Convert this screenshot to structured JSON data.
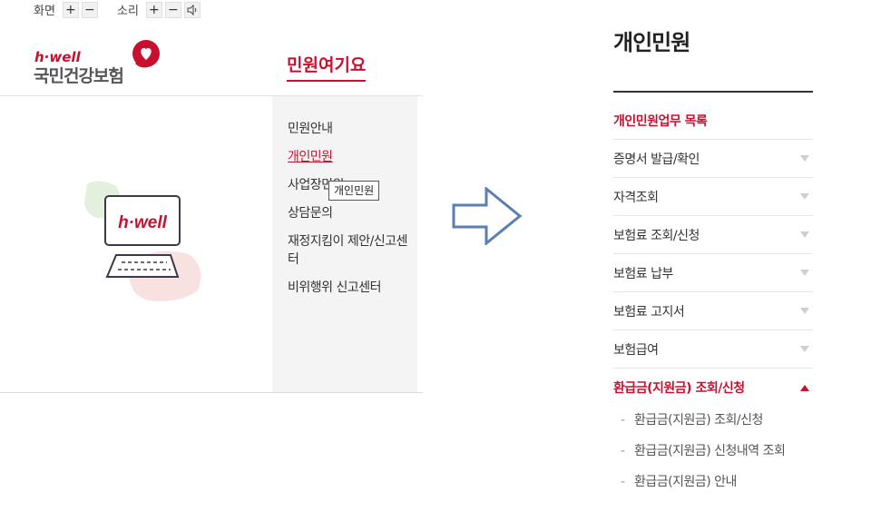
{
  "utility": {
    "screen_label": "화면",
    "sound_label": "소리",
    "plus": "+",
    "minus": "−"
  },
  "logo": {
    "brand": "h·well",
    "org": "국민건강보험"
  },
  "gnb": {
    "title": "민원여기요"
  },
  "illustration": {
    "screen_text": "h·well"
  },
  "submenu": {
    "items": [
      {
        "label": "민원안내"
      },
      {
        "label": "개인민원"
      },
      {
        "label": "사업장민원"
      },
      {
        "label": "상담문의"
      },
      {
        "label": "재정지킴이 제안/신고센터"
      },
      {
        "label": "비위행위 신고센터"
      }
    ],
    "tooltip": "개인민원"
  },
  "panel": {
    "title": "개인민원",
    "header": "개인민원업무 목록",
    "items": [
      {
        "label": "증명서 발급/확인"
      },
      {
        "label": "자격조회"
      },
      {
        "label": "보험료 조회/신청"
      },
      {
        "label": "보험료 납부"
      },
      {
        "label": "보험료 고지서"
      },
      {
        "label": "보험급여"
      },
      {
        "label": "환급금(지원금) 조회/신청"
      }
    ],
    "sub_items": [
      {
        "label": "환급금(지원금) 조회/신청"
      },
      {
        "label": "환급금(지원금) 신청내역 조회"
      },
      {
        "label": "환급금(지원금) 안내"
      }
    ],
    "dash": "-"
  },
  "colors": {
    "accent": "#c8102e",
    "arrow": "#5a7fb0"
  }
}
